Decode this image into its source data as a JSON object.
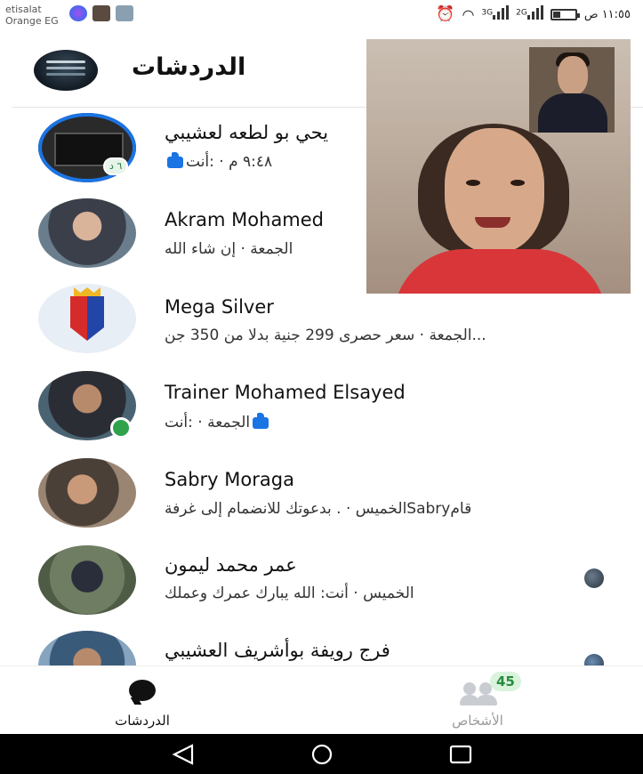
{
  "status_bar": {
    "carrier_line1": "etisalat",
    "carrier_line2": "Orange EG",
    "net1": "3G",
    "net2": "2G",
    "time": "١١:٥٥ ص"
  },
  "header": {
    "title": "الدردشات"
  },
  "chats": [
    {
      "name": "يحي بو لطعه لعشيبي",
      "subtitle": "٩:٤٨ م · :أنت",
      "badge": "٦ د",
      "has_like": true
    },
    {
      "name": "Akram Mohamed",
      "subtitle": "الجمعة · إن شاء الله",
      "has_like": false
    },
    {
      "name": "Mega Silver",
      "subtitle": "الجمعة · سعر حصرى 299 جنية بدلا من 350 جن...",
      "has_like": false
    },
    {
      "name": "Trainer Mohamed Elsayed",
      "subtitle": "الجمعة · :أنت",
      "has_like": true
    },
    {
      "name": "Sabry Moraga",
      "subtitle": "الخميس · . بدعوتك للانضمام إلى غرفةSabryقام",
      "has_like": false
    },
    {
      "name": "عمر محمد ليمون",
      "subtitle": "الخميس · أنت: الله يبارك عمرك وعملك",
      "has_like": false
    },
    {
      "name": "فرج رويفة بوأشريف العشيبي",
      "subtitle": "",
      "has_like": false
    }
  ],
  "bottom_nav": {
    "chats_label": "الدردشات",
    "people_label": "الأشخاص",
    "people_count": "45"
  },
  "colors": {
    "accent": "#1b74e4",
    "online": "#31a24c"
  }
}
